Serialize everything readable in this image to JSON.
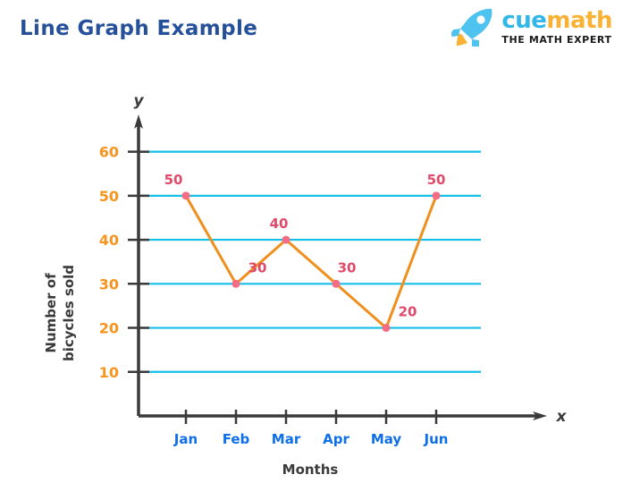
{
  "page_title": "Line Graph Example",
  "brand": {
    "icon": "rocket-icon",
    "name_part1": "cue",
    "name_part2": "math",
    "tagline": "THE MATH EXPERT",
    "colors": {
      "cue": "#32b7e8",
      "math": "#f9b233",
      "tagline": "#1a1a1a"
    }
  },
  "colors": {
    "title": "#27509b",
    "gridline": "#14bfe8",
    "axis": "#3a3a3a",
    "line": "#ef8f1c",
    "marker": "#f26d84",
    "point_label": "#e04a6a",
    "y_tick_label": "#f7941e",
    "x_tick_label": "#0f6fe8"
  },
  "chart_data": {
    "type": "line",
    "title": "Line Graph Example",
    "categories": [
      "Jan",
      "Feb",
      "Mar",
      "Apr",
      "May",
      "Jun"
    ],
    "values": [
      50,
      30,
      40,
      30,
      20,
      50
    ],
    "point_labels": [
      "50",
      "30",
      "40",
      "30",
      "20",
      "50"
    ],
    "xlabel": "Months",
    "ylabel": "Number of bicycles sold",
    "ylabel_line1": "Number of",
    "ylabel_line2": "bicycles sold",
    "x_axis_variable": "x",
    "y_axis_variable": "y",
    "yticks": [
      10,
      20,
      30,
      40,
      50,
      60
    ],
    "ytick_labels": [
      "10",
      "20",
      "30",
      "40",
      "50",
      "60"
    ],
    "ylim": [
      0,
      65
    ],
    "grid": true,
    "grid_axis": "y",
    "legend": false,
    "markers": true
  }
}
